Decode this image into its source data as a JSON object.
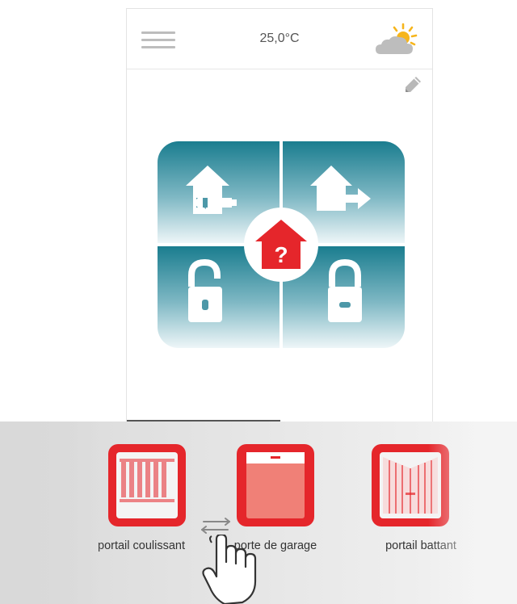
{
  "header": {
    "temperature": "25,0°C",
    "menu_icon": "hamburger-menu-icon",
    "weather_icon": "partly-sunny-icon"
  },
  "edit_icon": "pencil-icon",
  "control_pad": {
    "buttons": [
      {
        "name": "arrive-home-button",
        "icon": "house-arrow-in-icon"
      },
      {
        "name": "leave-home-button",
        "icon": "house-arrow-out-icon"
      },
      {
        "name": "unlock-button",
        "icon": "padlock-open-icon"
      },
      {
        "name": "lock-button",
        "icon": "padlock-closed-icon"
      }
    ],
    "status_icon": "house-question-icon",
    "status_symbol": "?",
    "colors": {
      "teal": "#1a7d8f",
      "status_red": "#e5262b"
    }
  },
  "carousel": {
    "items": [
      {
        "label": "portail coulissant",
        "icon": "sliding-gate-icon"
      },
      {
        "label": "porte de garage",
        "icon": "garage-door-icon"
      },
      {
        "label": "portail battant",
        "icon": "swing-gate-icon"
      }
    ],
    "swipe_icon": "swipe-arrows-icon",
    "hand_icon": "hand-pointer-icon",
    "accent_color": "#e5262b"
  }
}
